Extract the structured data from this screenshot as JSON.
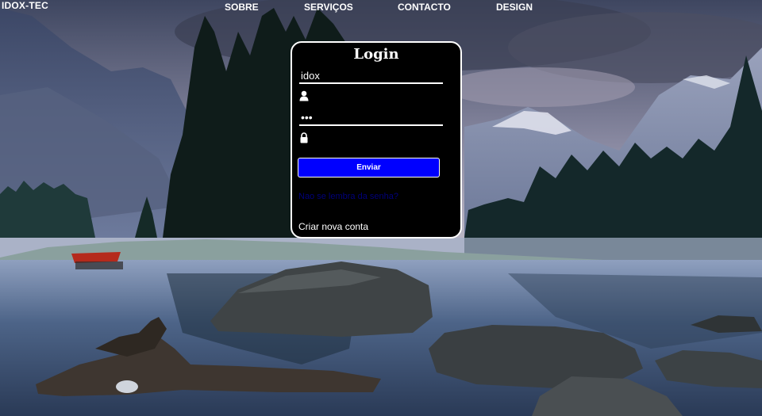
{
  "header": {
    "brand": "IDOX-TEC",
    "nav": {
      "sobre": "SOBRE",
      "servicos": "SERVIÇOS",
      "contacto": "CONTACTO",
      "design": "DESIGN"
    }
  },
  "login": {
    "title": "Login",
    "username_value": "idox",
    "password_value": "•••",
    "submit_label": "Enviar",
    "forgot_label": "Nao se lembra da senha?",
    "create_label": "Criar nova conta"
  },
  "icons": {
    "user": "user-icon",
    "lock": "lock-icon"
  },
  "colors": {
    "button": "#0000ff",
    "panel": "#000000",
    "forgot_link": "#00007a"
  }
}
